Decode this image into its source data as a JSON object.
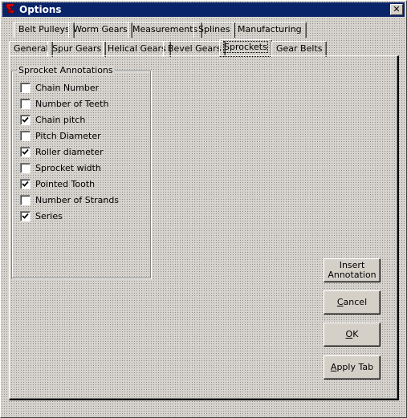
{
  "window": {
    "title": "Options",
    "close_glyph": "✕"
  },
  "tabs": {
    "row1": [
      {
        "label": "Belt Pulleys"
      },
      {
        "label": "Worm Gears"
      },
      {
        "label": "Measurements"
      },
      {
        "label": "Splines"
      },
      {
        "label": "Manufacturing"
      }
    ],
    "row2": [
      {
        "label": "General"
      },
      {
        "label": "Spur Gears"
      },
      {
        "label": "Helical Gears"
      },
      {
        "label": "Bevel Gears"
      },
      {
        "label": "Sprockets",
        "active": true
      },
      {
        "label": "Gear Belts"
      }
    ]
  },
  "group": {
    "title": "Sprocket Annotations",
    "items": [
      {
        "label": "Chain Number",
        "checked": false
      },
      {
        "label": "Number of Teeth",
        "checked": false
      },
      {
        "label": "Chain pitch",
        "checked": true
      },
      {
        "label": "Pitch Diameter",
        "checked": false
      },
      {
        "label": "Roller diameter",
        "checked": true
      },
      {
        "label": "Sprocket width",
        "checked": false
      },
      {
        "label": "Pointed Tooth",
        "checked": true
      },
      {
        "label": "Number of Strands",
        "checked": false
      },
      {
        "label": "Series",
        "checked": true
      }
    ]
  },
  "buttons": {
    "insert_line1": "Insert",
    "insert_line2": "Annotation",
    "cancel_first": "C",
    "cancel_rest": "ancel",
    "ok_first": "O",
    "ok_rest": "K",
    "apply_first": "A",
    "apply_rest": "pply Tab"
  },
  "colors": {
    "titlebar": "#0a246a",
    "face": "#d4d0c8",
    "logo_red": "#e00000"
  }
}
